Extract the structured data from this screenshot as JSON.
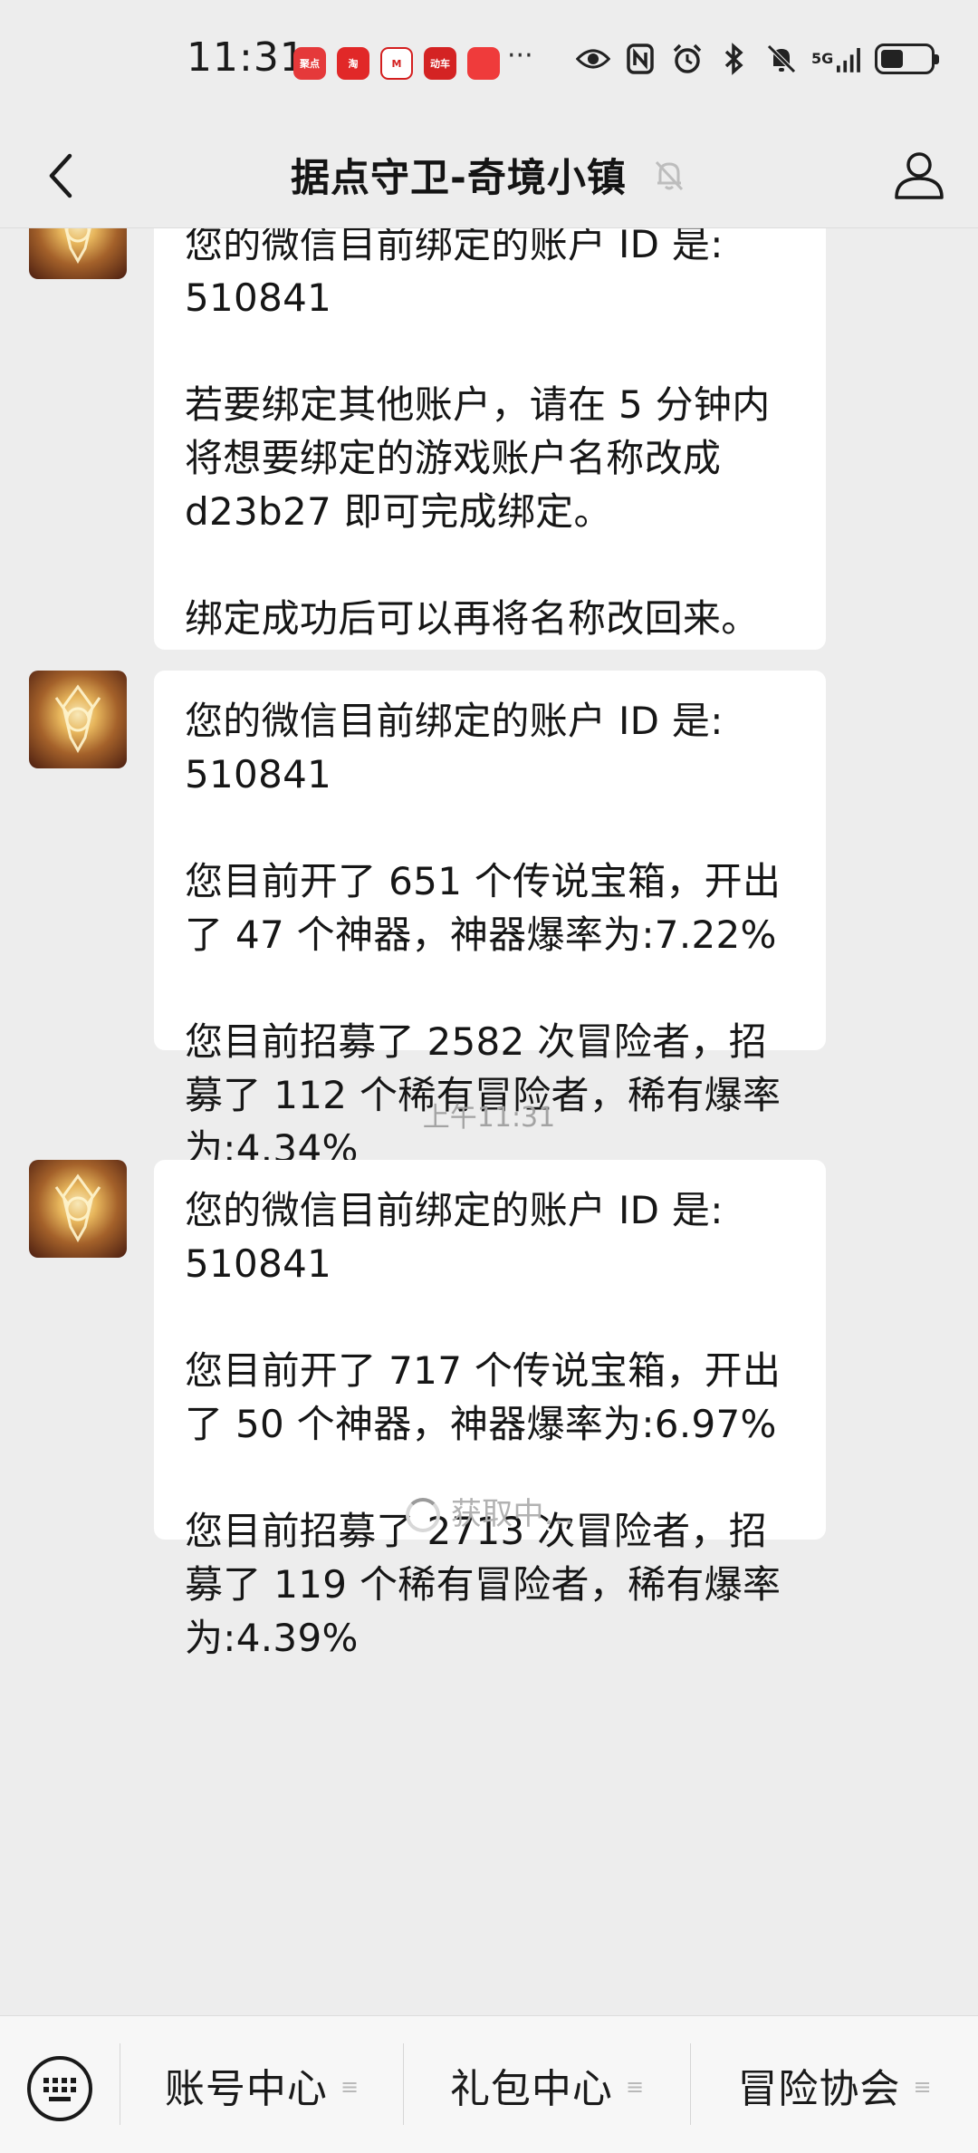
{
  "status_bar": {
    "time": "11:31",
    "app_badges": [
      {
        "label": "聚点"
      },
      {
        "label": "淘"
      },
      {
        "label": "M"
      },
      {
        "label": "动车"
      },
      {
        "label": ""
      }
    ],
    "more": "···",
    "network": "5G",
    "icons": [
      "eye-icon",
      "nfc-icon",
      "alarm-icon",
      "bluetooth-icon",
      "mute-icon",
      "signal-icon",
      "battery-icon"
    ]
  },
  "header": {
    "title": "据点守卫-奇境小镇"
  },
  "messages": [
    {
      "lines": [
        "您的微信目前绑定的账户 ID 是:",
        "510841",
        "",
        "若要绑定其他账户，请在 5 分钟内",
        "将想要绑定的游戏账户名称改成",
        "d23b27 即可完成绑定。",
        "",
        "绑定成功后可以再将名称改回来。"
      ]
    },
    {
      "lines": [
        "您的微信目前绑定的账户 ID 是:",
        "510841",
        "",
        "您目前开了 651 个传说宝箱，开出",
        "了 47 个神器，神器爆率为:7.22%",
        "",
        "您目前招募了 2582 次冒险者，招",
        "募了 112 个稀有冒险者，稀有爆率",
        "为:4.34%"
      ]
    },
    {
      "lines": [
        "您的微信目前绑定的账户 ID 是:",
        "510841",
        "",
        "您目前开了 717 个传说宝箱，开出",
        "了 50 个神器，神器爆率为:6.97%",
        "",
        "您目前招募了 2713 次冒险者，招",
        "募了 119 个稀有冒险者，稀有爆率",
        "为:4.39%"
      ]
    }
  ],
  "time_divider": "上午11:31",
  "loading_text": "获取中...",
  "bottom_menu": {
    "items": [
      {
        "label": "账号中心",
        "glyph": "≡"
      },
      {
        "label": "礼包中心",
        "glyph": "≡"
      },
      {
        "label": "冒险协会",
        "glyph": "≡"
      }
    ]
  }
}
